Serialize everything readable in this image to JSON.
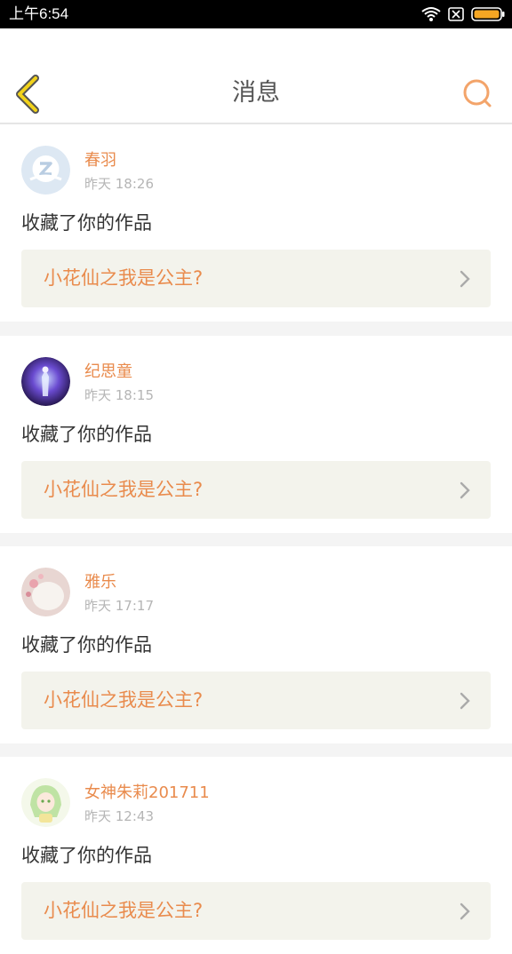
{
  "status_bar": {
    "time": "上午6:54"
  },
  "header": {
    "title": "消息"
  },
  "colors": {
    "accent": "#e98b4d",
    "back_arrow": "#f1d21a",
    "card_box": "#f3f3ec"
  },
  "messages": [
    {
      "name": "春羽",
      "time": "昨天 18:26",
      "action": "收藏了你的作品",
      "work": "小花仙之我是公主?",
      "avatar": "qzone-default-avatar"
    },
    {
      "name": "纪思童",
      "time": "昨天 18:15",
      "action": "收藏了你的作品",
      "work": "小花仙之我是公主?",
      "avatar": "purple-fantasy-avatar"
    },
    {
      "name": "雅乐",
      "time": "昨天 17:17",
      "action": "收藏了你的作品",
      "work": "小花仙之我是公主?",
      "avatar": "white-cat-avatar"
    },
    {
      "name": "女神朱莉201711",
      "time": "昨天 12:43",
      "action": "收藏了你的作品",
      "work": "小花仙之我是公主?",
      "avatar": "green-anime-girl-avatar"
    }
  ]
}
